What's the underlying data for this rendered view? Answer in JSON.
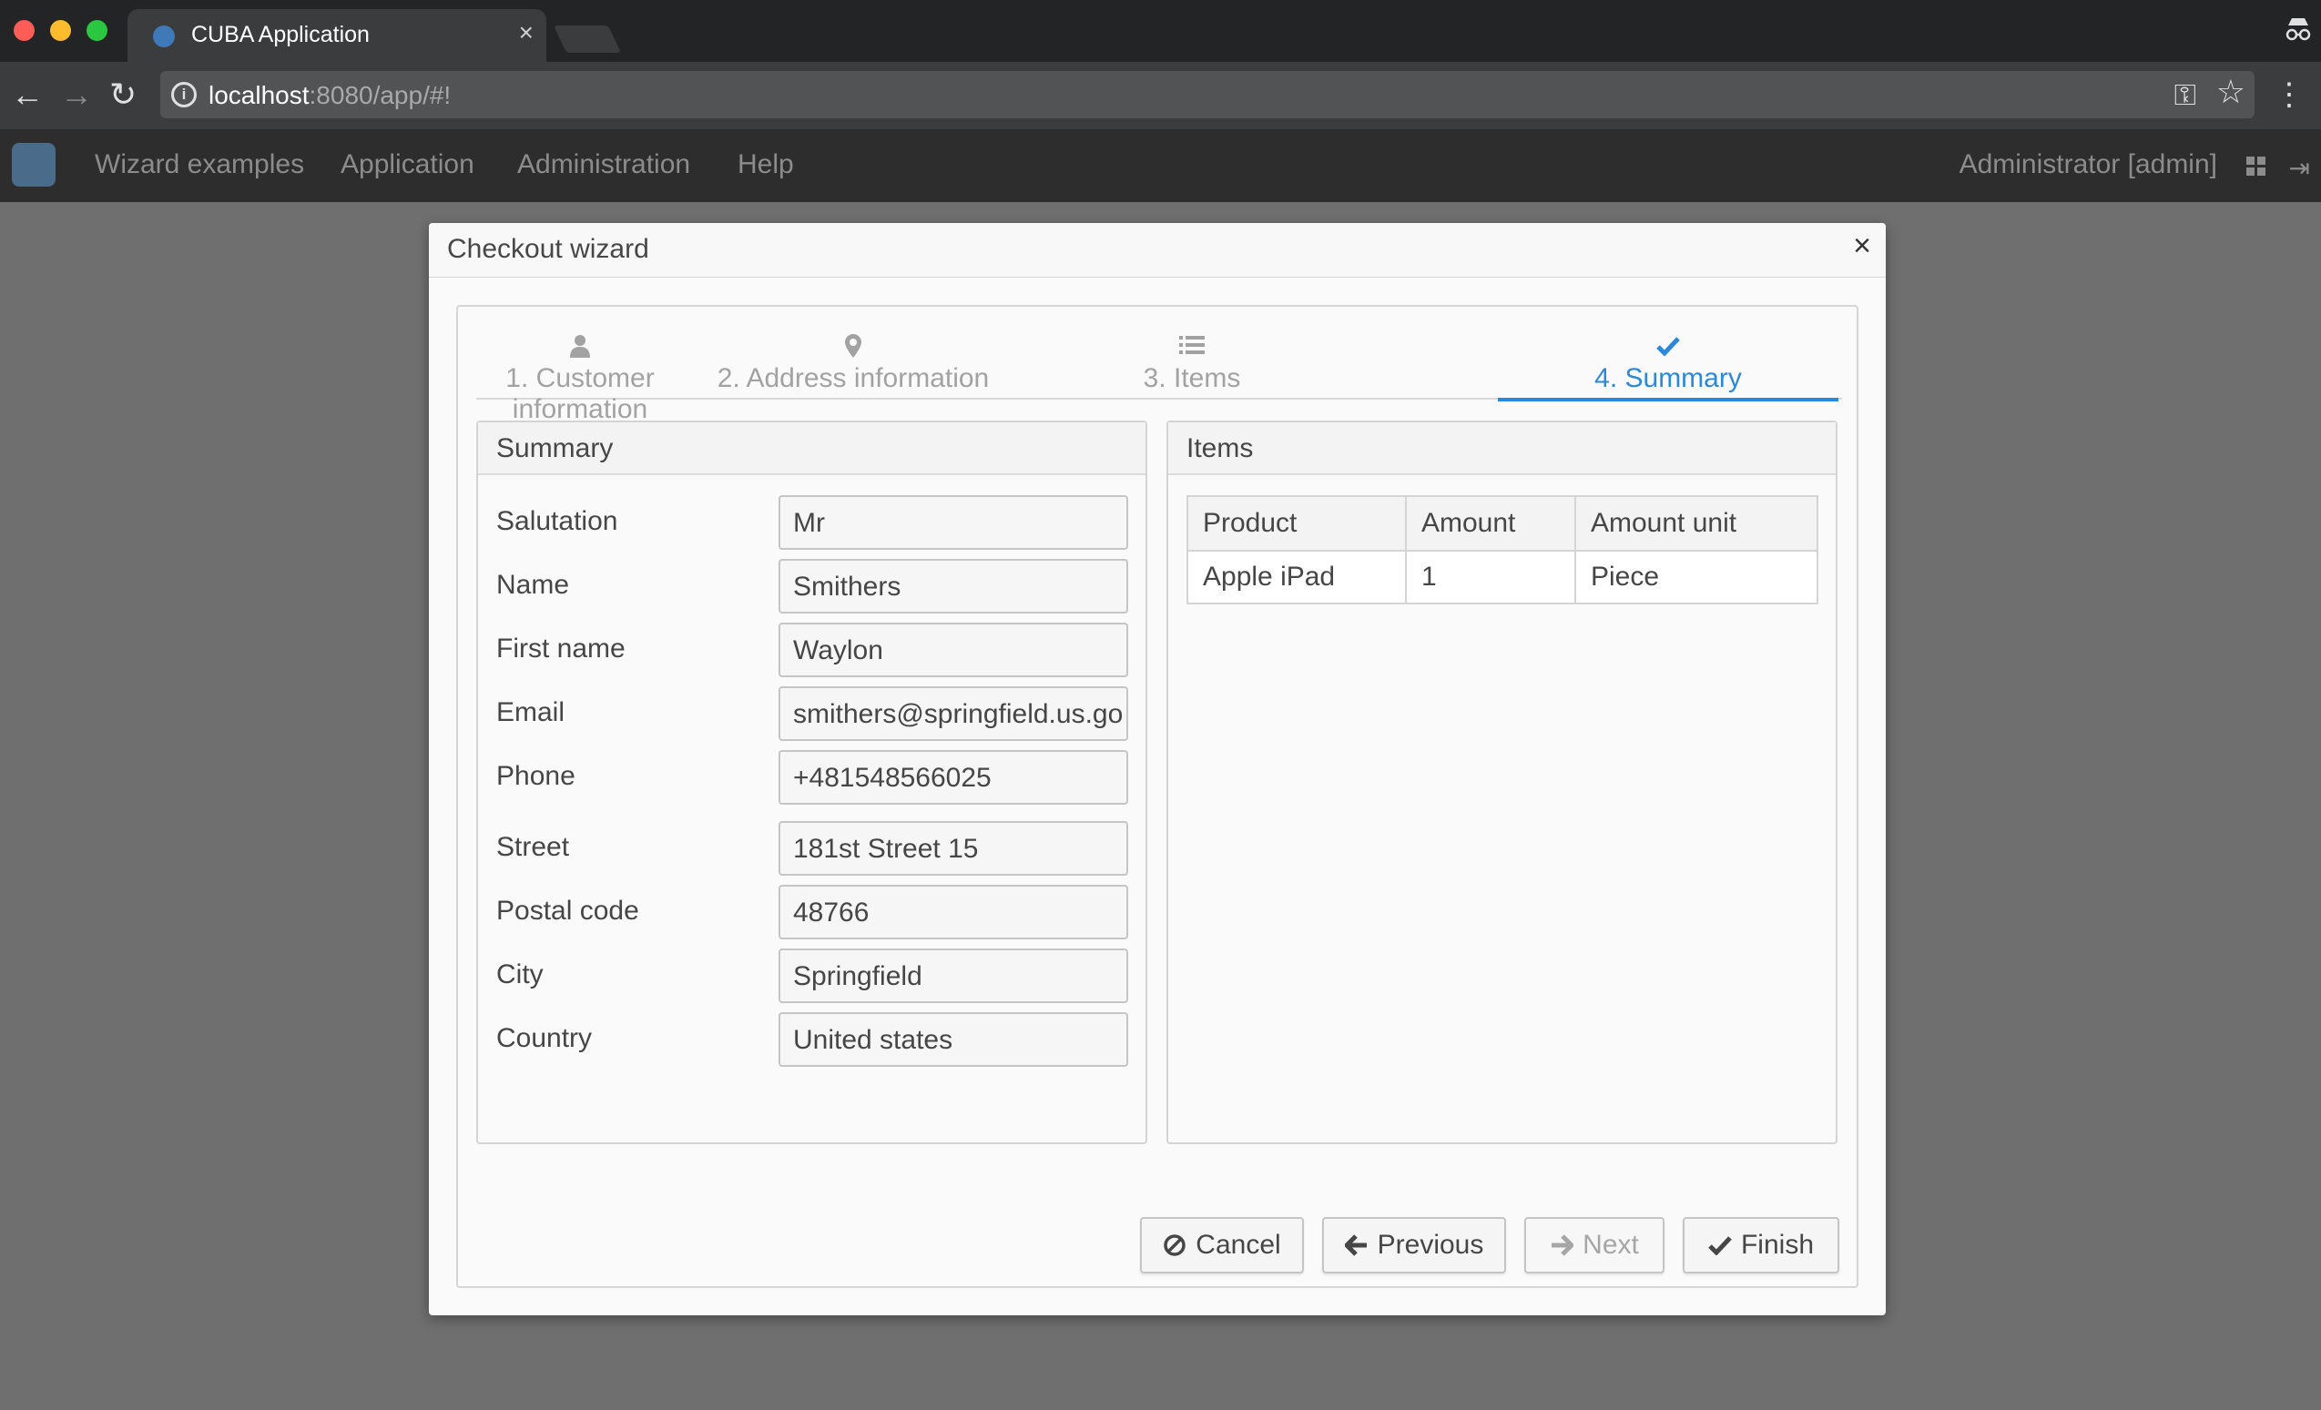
{
  "browser": {
    "tab_title": "CUBA Application",
    "tab_close": "×",
    "url_host": "localhost",
    "url_rest": ":8080/app/#!",
    "nav_back": "←",
    "nav_forward": "→",
    "nav_reload": "↻",
    "key_icon": "⚿",
    "star_icon": "☆",
    "menu_icon": "⋮"
  },
  "appbar": {
    "menu": [
      "Wizard examples",
      "Application",
      "Administration",
      "Help"
    ],
    "user": "Administrator [admin]",
    "logout_icon": "⇥"
  },
  "dialog": {
    "title": "Checkout wizard",
    "close": "×"
  },
  "steps": [
    {
      "label": "1. Customer information",
      "icon": "user-icon",
      "glyph": "👤"
    },
    {
      "label": "2. Address information",
      "icon": "map-marker-icon",
      "glyph": "⚲"
    },
    {
      "label": "3. Items",
      "icon": "list-icon",
      "glyph": "☰"
    },
    {
      "label": "4. Summary",
      "icon": "check-icon",
      "glyph": "✔",
      "active": true
    }
  ],
  "summary": {
    "title": "Summary",
    "fields": [
      {
        "label": "Salutation",
        "value": "Mr"
      },
      {
        "label": "Name",
        "value": "Smithers"
      },
      {
        "label": "First name",
        "value": "Waylon"
      },
      {
        "label": "Email",
        "value": "smithers@springfield.us.go"
      },
      {
        "label": "Phone",
        "value": "+481548566025"
      },
      {
        "label": "Street",
        "value": "181st Street 15"
      },
      {
        "label": "Postal code",
        "value": "48766"
      },
      {
        "label": "City",
        "value": "Springfield"
      },
      {
        "label": "Country",
        "value": "United states"
      }
    ]
  },
  "items": {
    "title": "Items",
    "columns": [
      "Product",
      "Amount",
      "Amount unit"
    ],
    "rows": [
      [
        "Apple iPad",
        "1",
        "Piece"
      ]
    ]
  },
  "buttons": {
    "cancel": {
      "label": "Cancel",
      "icon": "⊘"
    },
    "previous": {
      "label": "Previous",
      "icon": "🡐"
    },
    "next": {
      "label": "Next",
      "icon": "➔"
    },
    "finish": {
      "label": "Finish",
      "icon": "✔"
    }
  },
  "colors": {
    "accent": "#2c88d9",
    "overlay": "#6f6f6f",
    "appbar": "#2d2d2d"
  }
}
